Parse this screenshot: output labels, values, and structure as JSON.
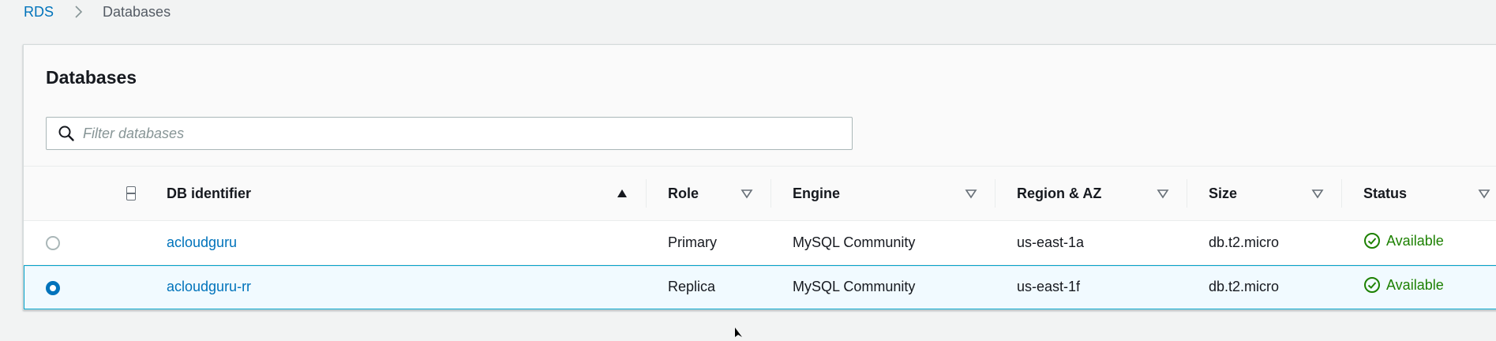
{
  "breadcrumb": {
    "root": "RDS",
    "current": "Databases"
  },
  "panel": {
    "title": "Databases",
    "search_placeholder": "Filter databases"
  },
  "table": {
    "columns": [
      {
        "label": "DB identifier",
        "sort": "ascending"
      },
      {
        "label": "Role",
        "sort": "none"
      },
      {
        "label": "Engine",
        "sort": "none"
      },
      {
        "label": "Region & AZ",
        "sort": "none"
      },
      {
        "label": "Size",
        "sort": "none"
      },
      {
        "label": "Status",
        "sort": "none"
      }
    ],
    "rows": [
      {
        "selected": false,
        "identifier": "acloudguru",
        "role": "Primary",
        "engine": "MySQL Community",
        "region": "us-east-1a",
        "size": "db.t2.micro",
        "status": "Available"
      },
      {
        "selected": true,
        "identifier": "acloudguru-rr",
        "role": "Replica",
        "engine": "MySQL Community",
        "region": "us-east-1f",
        "size": "db.t2.micro",
        "status": "Available"
      }
    ]
  },
  "colors": {
    "link": "#0073bb",
    "status_available": "#1d8102",
    "selected_row_bg": "#f1faff",
    "selected_row_border": "#00a1c9"
  },
  "icons": {
    "breadcrumb_separator": "chevron-right-icon",
    "search": "search-icon",
    "sort_ascending": "caret-up-filled-icon",
    "sort_none": "caret-down-outline-icon",
    "status_available": "check-circle-icon"
  }
}
